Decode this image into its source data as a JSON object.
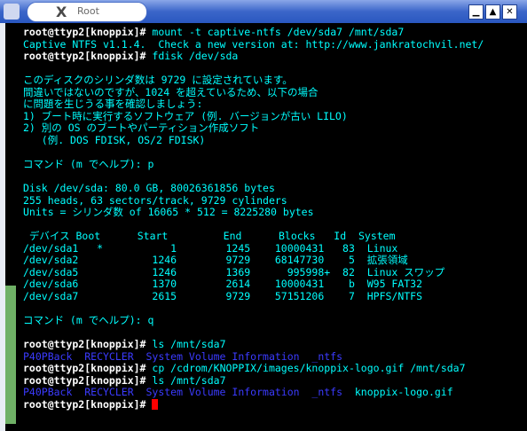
{
  "window": {
    "title": "Root",
    "minimize": "▁",
    "maximize": "▲",
    "close": "✕"
  },
  "terminal": {
    "lines": [
      {
        "prompt": "root@ttyp2[knoppix]#",
        "text": " mount -t captive-ntfs /dev/sda7 /mnt/sda7"
      },
      {
        "text": "Captive NTFS v1.1.4.  Check a new version at: http://www.jankratochvil.net/"
      },
      {
        "prompt": "root@ttyp2[knoppix]#",
        "text": " fdisk /dev/sda"
      },
      {
        "text": ""
      },
      {
        "text": "このディスクのシリンダ数は 9729 に設定されています。"
      },
      {
        "text": "間違いではないのですが、1024 を超えているため、以下の場合"
      },
      {
        "text": "に問題を生じうる事を確認しましょう:"
      },
      {
        "text": "1) ブート時に実行するソフトウェア (例. バージョンが古い LILO)"
      },
      {
        "text": "2) 別の OS のブートやパーティション作成ソフト"
      },
      {
        "text": "   (例. DOS FDISK, OS/2 FDISK)"
      },
      {
        "text": ""
      },
      {
        "text": "コマンド (m でヘルプ): p"
      },
      {
        "text": ""
      },
      {
        "text": "Disk /dev/sda: 80.0 GB, 80026361856 bytes"
      },
      {
        "text": "255 heads, 63 sectors/track, 9729 cylinders"
      },
      {
        "text": "Units = シリンダ数 of 16065 * 512 = 8225280 bytes"
      },
      {
        "text": ""
      },
      {
        "text": " デバイス Boot      Start         End      Blocks   Id  System"
      },
      {
        "text": "/dev/sda1   *           1        1245    10000431   83  Linux"
      },
      {
        "text": "/dev/sda2            1246        9729    68147730    5  拡張領域"
      },
      {
        "text": "/dev/sda5            1246        1369      995998+  82  Linux スワップ"
      },
      {
        "text": "/dev/sda6            1370        2614    10000431    b  W95 FAT32"
      },
      {
        "text": "/dev/sda7            2615        9729    57151206    7  HPFS/NTFS"
      },
      {
        "text": ""
      },
      {
        "text": "コマンド (m でヘルプ): q"
      },
      {
        "text": ""
      },
      {
        "prompt": "root@ttyp2[knoppix]#",
        "text": " ls /mnt/sda7"
      },
      {
        "blue": "P40PBack  RECYCLER  System Volume Information  _ntfs",
        "text": ""
      },
      {
        "prompt": "root@ttyp2[knoppix]#",
        "text": " cp /cdrom/KNOPPIX/images/knoppix-logo.gif /mnt/sda7"
      },
      {
        "prompt": "root@ttyp2[knoppix]#",
        "text": " ls /mnt/sda7"
      },
      {
        "blue": "P40PBack  RECYCLER  System Volume Information  _ntfs",
        "text": "  knoppix-logo.gif"
      },
      {
        "prompt": "root@ttyp2[knoppix]#",
        "text": " ",
        "cursor": true
      }
    ]
  },
  "colors": {
    "terminal_bg": "#000000",
    "text": "#00ffff",
    "prompt": "#ffffff",
    "directory": "#3b3bff",
    "cursor": "#ff0000",
    "scrollbar": "#6fb066",
    "titlebar": "#2a57c0"
  }
}
